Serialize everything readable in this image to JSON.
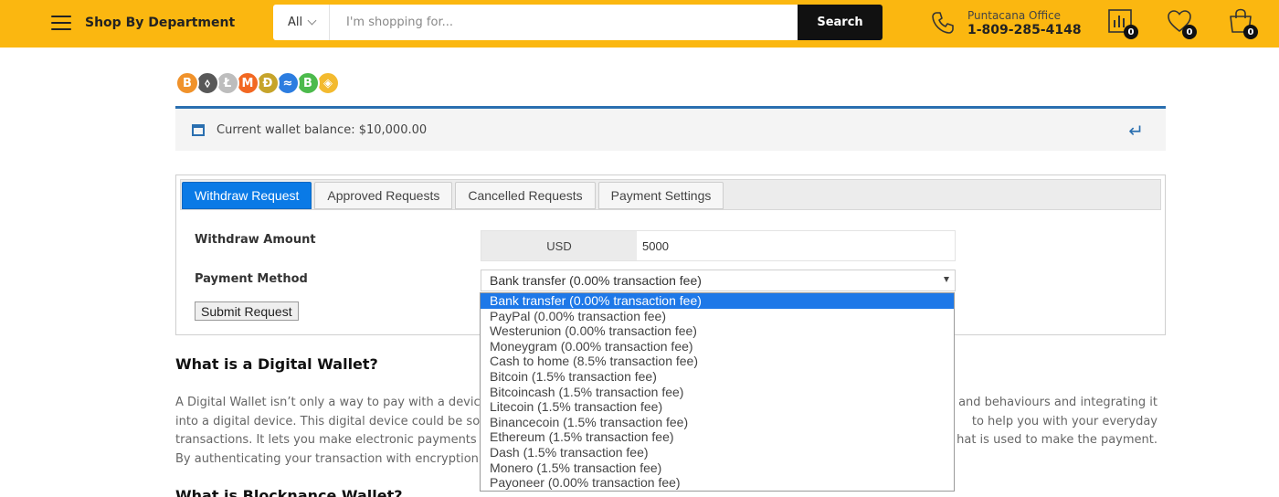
{
  "header": {
    "dept_label": "Shop By Department",
    "search": {
      "category": "All",
      "placeholder": "I'm shopping for...",
      "button": "Search"
    },
    "phone": {
      "label": "Puntacana Office",
      "number": "1-809-285-4148"
    },
    "badges": {
      "compare": "0",
      "wishlist": "0",
      "cart": "0"
    },
    "accent_color": "#fbb710"
  },
  "crypto_coins": [
    {
      "symbol": "B",
      "color": "#f0922b"
    },
    {
      "symbol": "⬨",
      "color": "#585858"
    },
    {
      "symbol": "Ł",
      "color": "#bdbdbd"
    },
    {
      "symbol": "M",
      "color": "#f26822"
    },
    {
      "symbol": "Ð",
      "color": "#c6a42b"
    },
    {
      "symbol": "≈",
      "color": "#2c7de0"
    },
    {
      "symbol": "B",
      "color": "#4cba4c"
    },
    {
      "symbol": "◈",
      "color": "#f3ba2f"
    }
  ],
  "wallet": {
    "balance_text": "Current wallet balance: $10,000.00"
  },
  "tabs": [
    {
      "label": "Withdraw Request",
      "active": true
    },
    {
      "label": "Approved Requests",
      "active": false
    },
    {
      "label": "Cancelled Requests",
      "active": false
    },
    {
      "label": "Payment Settings",
      "active": false
    }
  ],
  "form": {
    "amount_label": "Withdraw Amount",
    "currency": "USD",
    "amount_value": "5000",
    "method_label": "Payment Method",
    "method_selected": "Bank transfer (0.00% transaction fee)",
    "submit_label": "Submit Request"
  },
  "payment_options": [
    "Bank transfer (0.00% transaction fee)",
    "PayPal (0.00% transaction fee)",
    "Westerunion (0.00% transaction fee)",
    "Moneygram (0.00% transaction fee)",
    "Cash to home (8.5% transaction fee)",
    "Bitcoin (1.5% transaction fee)",
    "Bitcoincash (1.5% transaction fee)",
    "Litecoin (1.5% transaction fee)",
    "Binancecoin (1.5% transaction fee)",
    "Ethereum (1.5% transaction fee)",
    "Dash (1.5% transaction fee)",
    "Monero (1.5% transaction fee)",
    "Payoneer (0.00% transaction fee)"
  ],
  "article": {
    "heading1": "What is a Digital Wallet?",
    "paragraph_lines": [
      "A Digital Wallet isn’t only a way to pay with a device,",
      "into a digital device. This digital device could be som",
      "transactions. It lets you make electronic payments w",
      "By authenticating your transaction with encryption, t"
    ],
    "paragraph_lines_right": [
      "and behaviours and integrating it",
      "to help you with your everyday",
      "hat is used to make the payment.",
      ""
    ],
    "heading2": "What is Blocknance Wallet?"
  }
}
